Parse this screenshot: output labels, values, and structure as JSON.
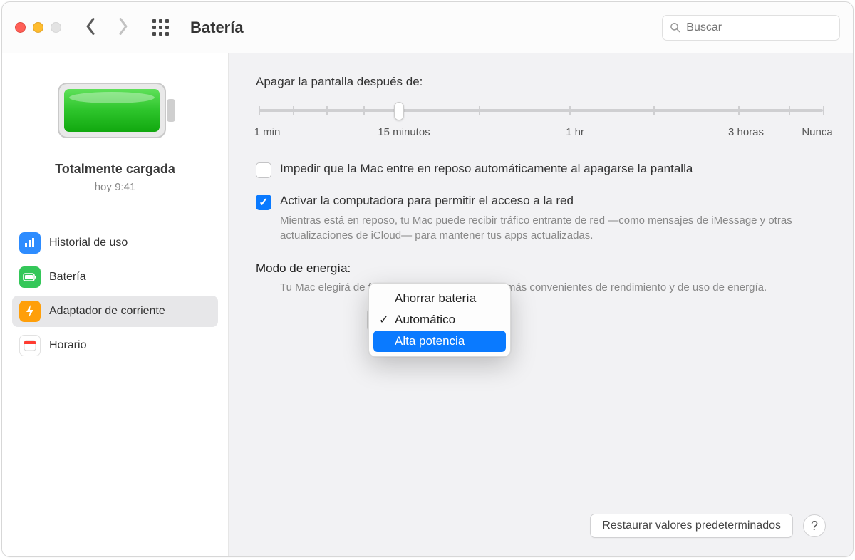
{
  "window": {
    "title": "Batería"
  },
  "search": {
    "placeholder": "Buscar"
  },
  "sidebar": {
    "status_title": "Totalmente cargada",
    "status_sub": "hoy 9:41",
    "items": [
      {
        "label": "Historial de uso"
      },
      {
        "label": "Batería"
      },
      {
        "label": "Adaptador de corriente"
      },
      {
        "label": "Horario"
      }
    ]
  },
  "slider": {
    "label": "Apagar la pantalla después de:",
    "ticks": [
      "1 min",
      "15 minutos",
      "1 hr",
      "3 horas",
      "Nunca"
    ]
  },
  "check1": {
    "label": "Impedir que la Mac entre en reposo automáticamente al apagarse la pantalla"
  },
  "check2": {
    "label": "Activar la computadora para permitir el acceso a la red",
    "desc": "Mientras está en reposo, tu Mac puede recibir tráfico entrante de red —como mensajes de iMessage y otras actualizaciones de iCloud— para mantener tus apps actualizadas."
  },
  "mode": {
    "label": "Modo de energía:",
    "desc": "Tu Mac elegirá de forma automática los niveles más convenientes de rendimiento y de uso de energía."
  },
  "popup": {
    "options": [
      "Ahorrar batería",
      "Automático",
      "Alta potencia"
    ],
    "selected": "Automático",
    "highlighted": "Alta potencia"
  },
  "footer": {
    "restore": "Restaurar valores predeterminados",
    "help": "?"
  }
}
